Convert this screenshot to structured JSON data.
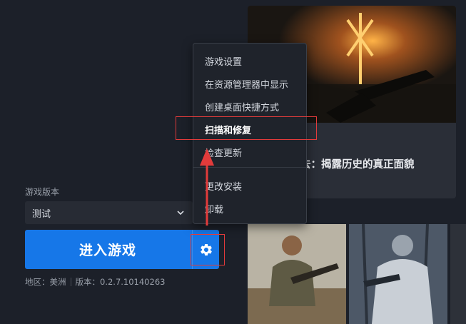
{
  "left_panel": {
    "version_label": "游戏版本",
    "version_selected": "测试",
    "play_button": "进入游戏",
    "region_text": "地区：美洲",
    "version_text": "版本：0.2.7.10140263"
  },
  "banner": {
    "title": "去：揭露历史的真正面貌"
  },
  "context_menu": {
    "items": [
      {
        "label": "游戏设置"
      },
      {
        "label": "在资源管理器中显示"
      },
      {
        "label": "创建桌面快捷方式"
      },
      {
        "label": "扫描和修复"
      },
      {
        "label": "检查更新"
      },
      {
        "label": "更改安装"
      },
      {
        "label": "卸载"
      }
    ]
  },
  "colors": {
    "background": "#1c2029",
    "play_button": "#1677e8",
    "highlight": "#e23b3b"
  },
  "icons": {
    "settings": "gear-icon",
    "dropdown": "chevron-down-icon"
  }
}
